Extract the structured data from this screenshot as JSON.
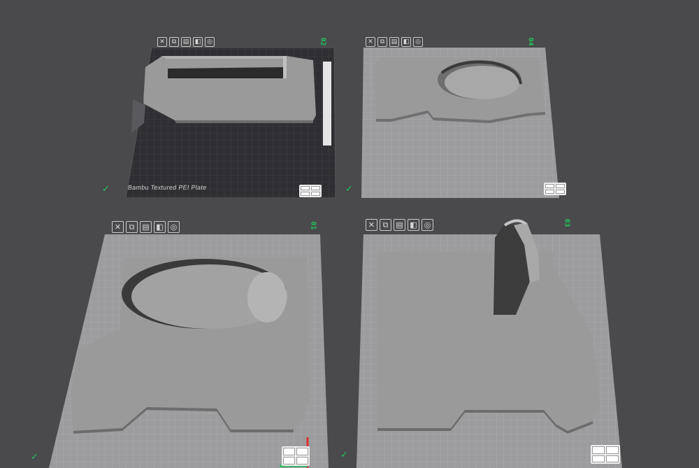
{
  "toolbar_icons": [
    "close-icon",
    "arrange-icon",
    "orient-icon",
    "lock-icon",
    "settings-icon"
  ],
  "toolbar_glyphs": [
    "✕",
    "⧉",
    "▤",
    "◧",
    "◎"
  ],
  "plates": [
    {
      "number": "02",
      "label": "Bambu Textured PEI Plate",
      "selected": true
    },
    {
      "number": "04",
      "label": "",
      "selected": false
    },
    {
      "number": "01",
      "label": "",
      "selected": false
    },
    {
      "number": "03",
      "label": "",
      "selected": false
    }
  ],
  "colors": {
    "background": "#4a4a4d",
    "plate_light": "#9c9c9e",
    "plate_dark": "#2f2f33",
    "model": "#9a9a9a",
    "accent_green": "#22c25a"
  },
  "check_mark": "✓"
}
